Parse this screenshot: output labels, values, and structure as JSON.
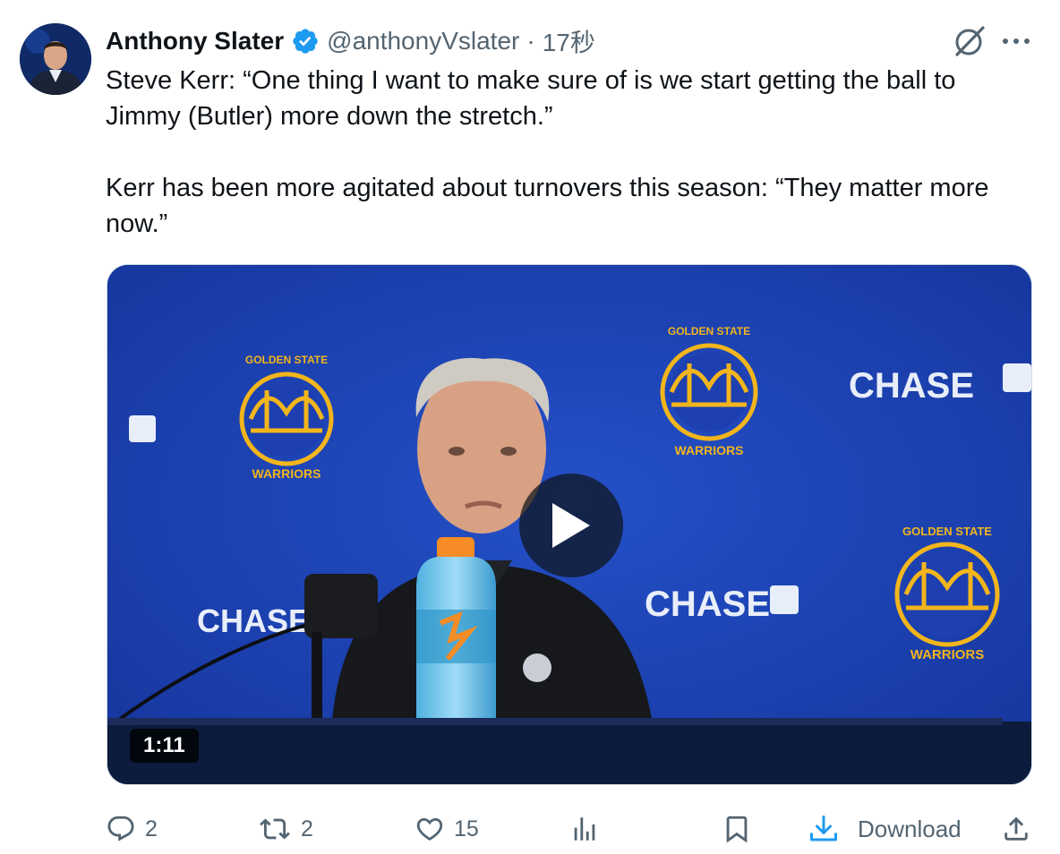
{
  "tweet": {
    "author_name": "Anthony Slater",
    "handle": "@anthonyVslater",
    "separator": "·",
    "time": "17秒",
    "text_lines": [
      "Steve Kerr: “One thing I want to make sure of is we start getting the ball to Jimmy (Butler) more down the stretch.”",
      "Kerr has been more agitated about turnovers this season: “They matter more now.”"
    ]
  },
  "media": {
    "duration": "1:11",
    "backdrop_text": {
      "sponsor": "CHASE",
      "team_top": "GOLDEN STATE",
      "team_bottom": "WARRIORS"
    }
  },
  "actions": {
    "reply_count": "2",
    "repost_count": "2",
    "like_count": "15",
    "download_label": "Download"
  },
  "colors": {
    "text": "#0f1419",
    "secondary": "#536471",
    "verified": "#1d9bf0",
    "backdrop_blue": "#1d3fb0",
    "warriors_gold": "#f2b51c"
  },
  "icons": [
    "verified-badge-icon",
    "grok-icon",
    "more-icon",
    "play-icon",
    "reply-icon",
    "repost-icon",
    "like-icon",
    "views-icon",
    "bookmark-icon",
    "download-icon",
    "share-icon"
  ]
}
